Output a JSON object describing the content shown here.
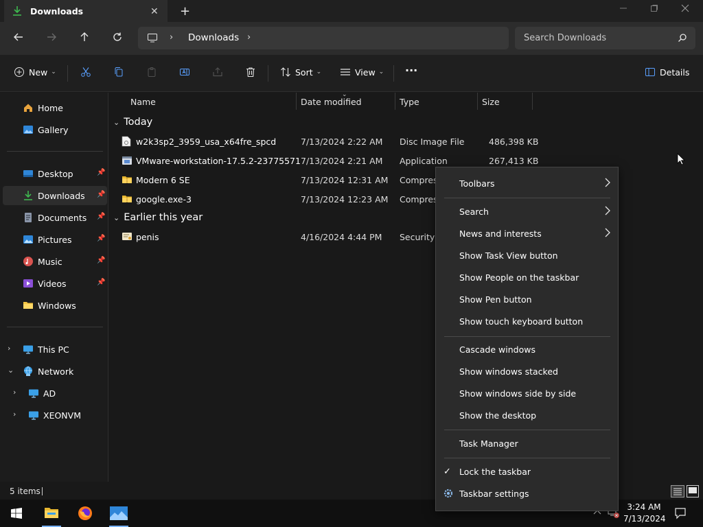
{
  "window": {
    "tab_title": "Downloads",
    "new_tab": "+",
    "tab_close": "✕"
  },
  "nav": {
    "breadcrumb": "Downloads",
    "search_placeholder": "Search Downloads"
  },
  "commands": {
    "new_label": "New",
    "sort_label": "Sort",
    "view_label": "View",
    "more_label": "···",
    "details_label": "Details"
  },
  "sidebar": {
    "quick": [
      {
        "label": "Home",
        "icon": "home-icon"
      },
      {
        "label": "Gallery",
        "icon": "gallery-icon"
      }
    ],
    "pinned": [
      {
        "label": "Desktop",
        "icon": "desktop-icon",
        "pinned": true
      },
      {
        "label": "Downloads",
        "icon": "download-icon",
        "pinned": true,
        "selected": true
      },
      {
        "label": "Documents",
        "icon": "documents-icon",
        "pinned": true
      },
      {
        "label": "Pictures",
        "icon": "pictures-icon",
        "pinned": true
      },
      {
        "label": "Music",
        "icon": "music-icon",
        "pinned": true
      },
      {
        "label": "Videos",
        "icon": "videos-icon",
        "pinned": true
      },
      {
        "label": "Windows",
        "icon": "folder-icon",
        "pinned": false
      }
    ],
    "tree": [
      {
        "label": "This PC",
        "icon": "this-pc-icon",
        "expander": "›"
      },
      {
        "label": "Network",
        "icon": "network-icon",
        "expander": "⌄"
      },
      {
        "label": "AD",
        "icon": "computer-icon",
        "expander": "›"
      },
      {
        "label": "XEONVM",
        "icon": "computer-icon",
        "expander": "›"
      }
    ]
  },
  "columns": {
    "name": "Name",
    "date": "Date modified",
    "type": "Type",
    "size": "Size"
  },
  "groups": {
    "today": "Today",
    "earlier": "Earlier this year"
  },
  "files": [
    {
      "name": "w2k3sp2_3959_usa_x64fre_spcd",
      "date": "7/13/2024 2:22 AM",
      "type": "Disc Image File",
      "size": "486,398 KB",
      "icon": "disc-image-icon"
    },
    {
      "name": "VMware-workstation-17.5.2-23775571",
      "date": "7/13/2024 2:21 AM",
      "type": "Application",
      "size": "267,413 KB",
      "icon": "application-icon"
    },
    {
      "name": "Modern 6 SE",
      "date": "7/13/2024 12:31 AM",
      "type": "Compress",
      "size": "",
      "icon": "zip-folder-icon"
    },
    {
      "name": "google.exe-3",
      "date": "7/13/2024 12:23 AM",
      "type": "Compress",
      "size": "",
      "icon": "zip-folder-icon"
    },
    {
      "name": "penis",
      "date": "4/16/2024 4:44 PM",
      "type": "Security C",
      "size": "",
      "icon": "certificate-icon"
    }
  ],
  "status": {
    "item_count": "5 items"
  },
  "context_menu": {
    "items": [
      {
        "label": "Toolbars",
        "submenu": true
      },
      {
        "label": "Search",
        "submenu": true
      },
      {
        "label": "News and interests",
        "submenu": true
      },
      {
        "label": "Show Task View button"
      },
      {
        "label": "Show People on the taskbar"
      },
      {
        "label": "Show Pen button"
      },
      {
        "label": "Show touch keyboard button"
      },
      {
        "label": "Cascade windows"
      },
      {
        "label": "Show windows stacked"
      },
      {
        "label": "Show windows side by side"
      },
      {
        "label": "Show the desktop"
      },
      {
        "label": "Task Manager"
      },
      {
        "label": "Lock the taskbar",
        "checked": true
      },
      {
        "label": "Taskbar settings",
        "icon": "gear-icon"
      }
    ]
  },
  "taskbar": {
    "time": "3:24 AM",
    "date": "7/13/2024"
  },
  "colors": {
    "accent": "#7ab3ff",
    "folder": "#f4c542",
    "download_green": "#3fb950",
    "background": "#191919"
  }
}
